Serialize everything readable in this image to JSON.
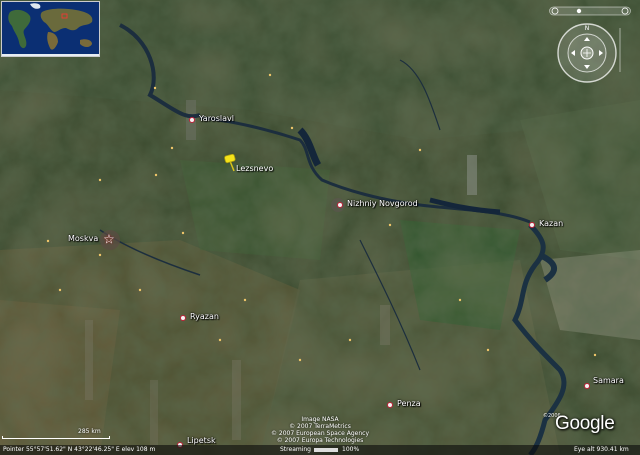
{
  "map": {
    "imagery": "satellite",
    "cities": [
      {
        "name": "Yaroslavl",
        "type": "city"
      },
      {
        "name": "Moskva",
        "type": "capital"
      },
      {
        "name": "Nizhniy Novgorod",
        "type": "city"
      },
      {
        "name": "Kazan",
        "type": "city"
      },
      {
        "name": "Ryazan",
        "type": "city"
      },
      {
        "name": "Penza",
        "type": "city"
      },
      {
        "name": "Samara",
        "type": "city"
      },
      {
        "name": "Lipetsk",
        "type": "city"
      }
    ],
    "placemark": {
      "label": "Lezsnevo",
      "color": "#f4e21a",
      "icon": "pushpin-icon"
    }
  },
  "overview_map": {
    "icon": "world-overview-map"
  },
  "navigation": {
    "compass": {
      "north_label": "N",
      "icon": "compass-ring-icon"
    },
    "buttons": [
      "look-joystick",
      "move-joystick",
      "zoom-slider"
    ]
  },
  "attribution": {
    "lines": [
      "Image NASA",
      "© 2007 TerraMetrics",
      "© 2007 European Space Agency",
      "© 2007 Europa Technologies"
    ],
    "copyright_year": "©2006",
    "logo": "Google"
  },
  "scale": {
    "label": "285 km"
  },
  "status": {
    "pointer": "Pointer  55°57'51.62\" N   43°22'46.25\" E   elev  108 m",
    "streaming_label": "Streaming",
    "streaming_percent": "100%",
    "eye_alt": "Eye alt  930.41 km"
  },
  "colors": {
    "city_marker": "#c2223a",
    "placemark": "#f4e21a",
    "label_text": "#ffffff"
  }
}
